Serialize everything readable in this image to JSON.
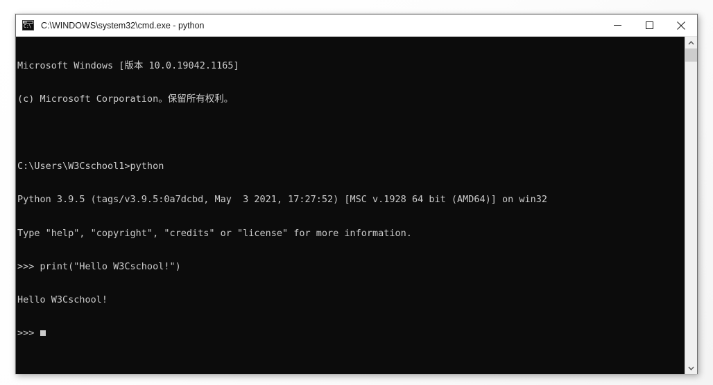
{
  "window": {
    "title": "C:\\WINDOWS\\system32\\cmd.exe - python",
    "icon": "cmd-console-icon",
    "icon_text": "C:\\",
    "controls": {
      "minimize_label": "Minimize",
      "maximize_label": "Maximize",
      "close_label": "Close"
    },
    "colors": {
      "title_bar_background": "#ffffff",
      "title_text": "#1a1a1a",
      "console_background": "#0c0c0c",
      "console_text": "#cccccc",
      "window_border": "#6e6e6e",
      "scrollbar_track": "#f0f0f0",
      "scrollbar_thumb": "#cdcdcd",
      "close_hover": "#e81123"
    }
  },
  "console": {
    "lines": [
      "Microsoft Windows [版本 10.0.19042.1165]",
      "(c) Microsoft Corporation。保留所有权利。",
      "",
      "C:\\Users\\W3Cschool1>python",
      "Python 3.9.5 (tags/v3.9.5:0a7dcbd, May  3 2021, 17:27:52) [MSC v.1928 64 bit (AMD64)] on win32",
      "Type \"help\", \"copyright\", \"credits\" or \"license\" for more information.",
      ">>> print(\"Hello W3Cschool!\")",
      "Hello W3Cschool!"
    ],
    "prompt": ">>> ",
    "cursor": "block-cursor"
  },
  "scrollbar": {
    "up_arrow": "chevron-up-icon",
    "down_arrow": "chevron-down-icon",
    "thumb_label": "scroll-thumb"
  }
}
